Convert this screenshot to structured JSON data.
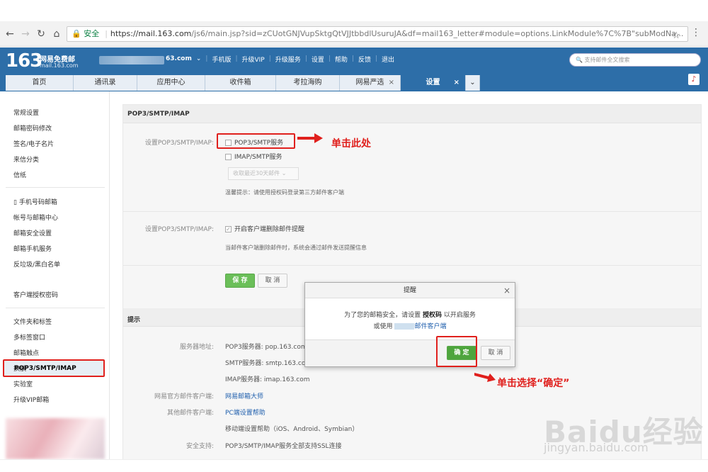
{
  "browser": {
    "secure_label": "安全",
    "url_host": "https://mail.163.com",
    "url_path": "/js6/main.jsp?sid=zCUotGNJVupSktgQtVJJtbbdlUsuruJA&df=mail163_letter#module=options.LinkModule%7C%7B\"subModNa...",
    "icons": [
      "back-icon",
      "forward-icon",
      "reload-icon",
      "home-icon",
      "lock-icon",
      "star-icon",
      "kebab-icon"
    ]
  },
  "header": {
    "logo_num": "163",
    "logo_title": "网易免费邮",
    "logo_domain": "mail.163.com",
    "account_suffix": "63.com",
    "nav": [
      "手机版",
      "升级VIP",
      "升级服务",
      "设置",
      "帮助",
      "反馈",
      "退出"
    ],
    "search_placeholder": "支持邮件全文搜索"
  },
  "tabs": [
    {
      "label": "首页"
    },
    {
      "label": "通讯录"
    },
    {
      "label": "应用中心"
    },
    {
      "label": "收件箱"
    },
    {
      "label": "考拉海购"
    },
    {
      "label": "网易严选"
    },
    {
      "label": "设置"
    }
  ],
  "sidebar": {
    "group1": [
      "常规设置",
      "邮箱密码修改",
      "签名/电子名片",
      "来信分类",
      "信纸"
    ],
    "group2": [
      "手机号码邮箱",
      "帐号与邮箱中心",
      "邮箱安全设置",
      "邮箱手机服务",
      "反垃圾/黑白名单",
      "POP3/SMTP/IMAP",
      "客户端授权密码"
    ],
    "group3": [
      "文件夹和标签",
      "多标签窗口",
      "邮箱触点",
      "换肤",
      "实验室",
      "升级VIP邮箱"
    ]
  },
  "main": {
    "section_title": "POP3/SMTP/IMAP",
    "setting_label": "设置POP3/SMTP/IMAP:",
    "opt_pop3": "POP3/SMTP服务",
    "opt_imap": "IMAP/SMTP服务",
    "select_text": "收取最近30天邮件",
    "tip": "温馨提示：请使用授权码登录第三方邮件客户端",
    "setting_label2": "设置POP3/SMTP/IMAP:",
    "opt_delete": "开启客户端删除邮件提醒",
    "delete_desc": "当邮件客户端删除邮件时，系统会通过邮件发送提醒信息",
    "save_btn": "保 存",
    "cancel_btn": "取 消",
    "hint_title": "提示",
    "rows": [
      {
        "label": "服务器地址:",
        "value": "POP3服务器: pop.163.com"
      },
      {
        "label": "",
        "value": "SMTP服务器: smtp.163.com"
      },
      {
        "label": "",
        "value": "IMAP服务器: imap.163.com"
      },
      {
        "label": "网易官方邮件客户端:",
        "value": "网易邮箱大师"
      },
      {
        "label": "其他邮件客户端:",
        "value": "PC端设置帮助"
      },
      {
        "label": "",
        "value": "移动端设置帮助（iOS、Android、Symbian）"
      },
      {
        "label": "安全支持:",
        "value": "POP3/SMTP/IMAP服务全部支持SSL连接"
      }
    ]
  },
  "dialog": {
    "title": "提醒",
    "line1_pre": "为了您的邮箱安全，请设置",
    "line1_key": "授权码",
    "line1_post": "以开启服务",
    "line2_pre": "或使用",
    "line2_link": "邮件客户端",
    "ok": "确 定",
    "cancel": "取 消"
  },
  "annotations": {
    "click_here": "单击此处",
    "click_confirm": "单击选择“确定”"
  },
  "watermark": {
    "brand": "Baidu经验",
    "domain": "jingyan.baidu.com"
  },
  "colors": {
    "header": "#2d6ea8",
    "annotation": "#e0201d",
    "save_green": "#6bbf59",
    "link": "#1f5fad"
  }
}
